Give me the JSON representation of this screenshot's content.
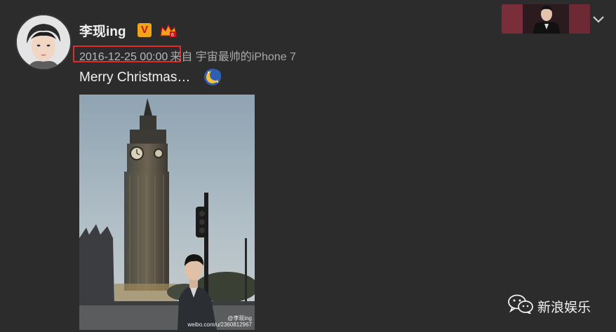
{
  "post": {
    "username": "李现ing",
    "verified_badge": "V",
    "timestamp": "2016-12-25 00:00",
    "source": "来自 宇宙最帅的iPhone 7",
    "text": "Merry Christmas…",
    "text_emoji": "moon-icon",
    "image_watermark_line1": "@李现ing",
    "image_watermark_line2": "weibo.com/u/2360812967"
  },
  "brand": {
    "name": "新浪娱乐",
    "icon": "wechat-icon"
  },
  "colors": {
    "background": "#2c2c2c",
    "highlight_box": "#e12b2b",
    "badge": "#f2a31c",
    "meta_text": "#a9a9a9"
  }
}
